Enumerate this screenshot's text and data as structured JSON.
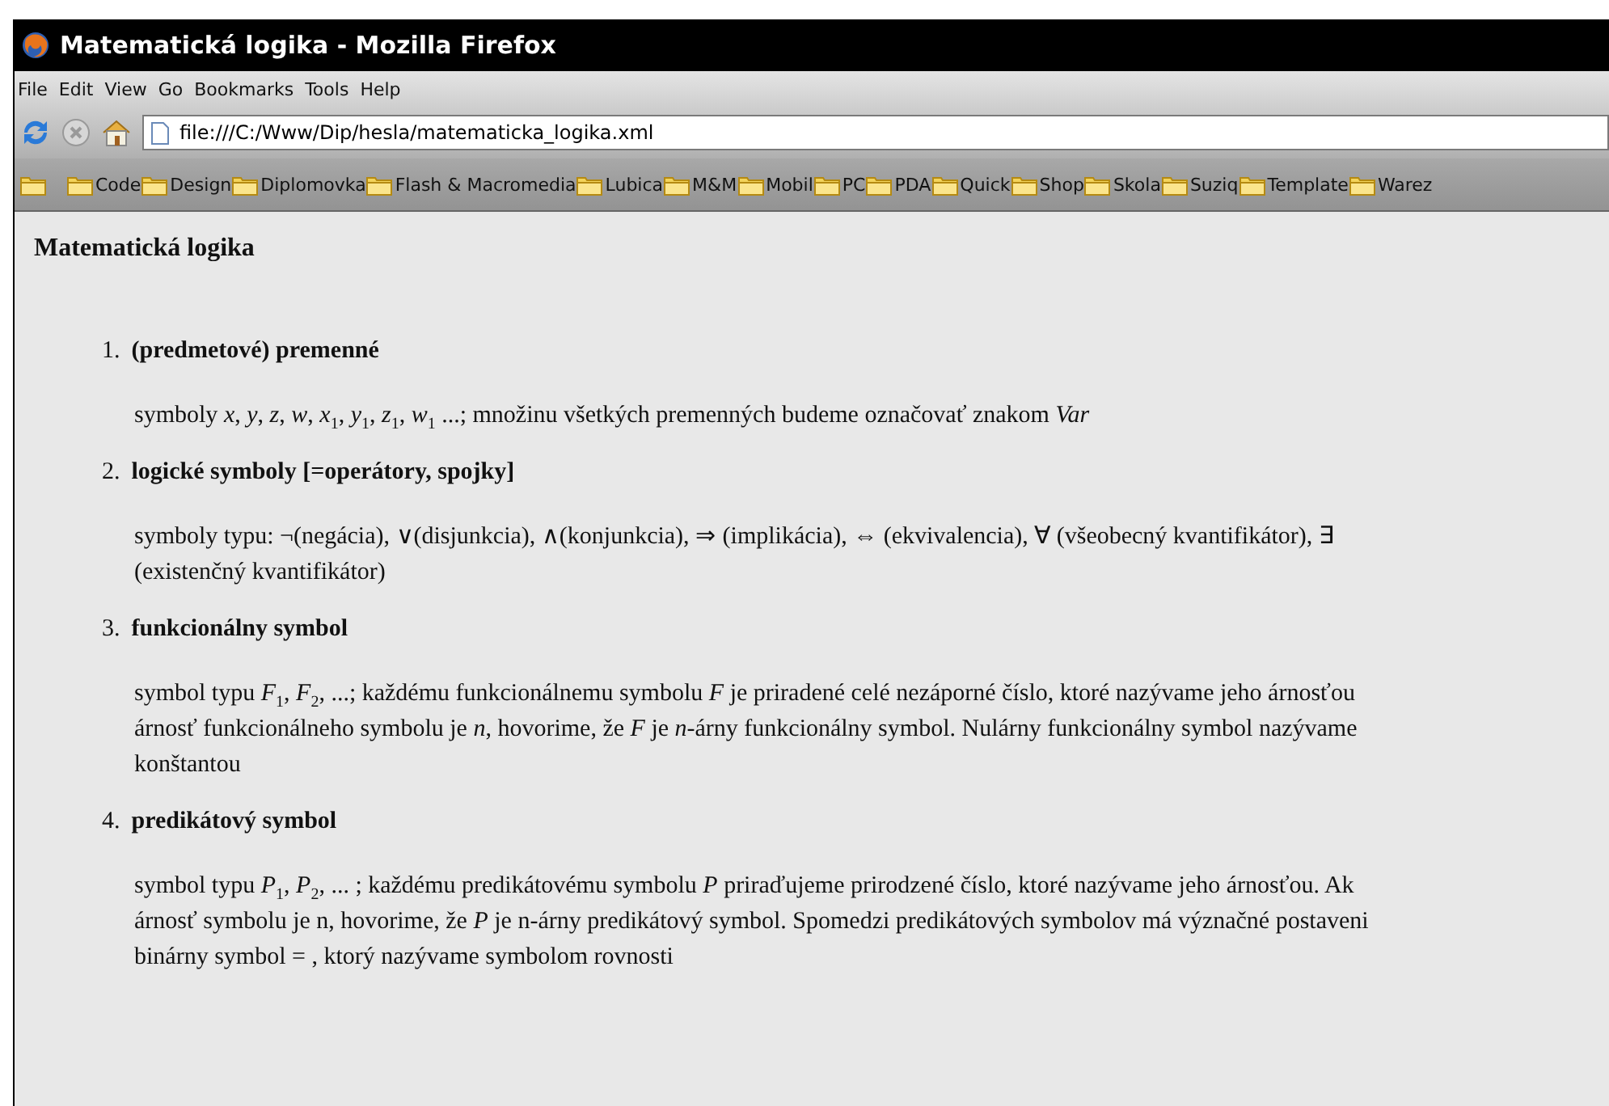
{
  "window": {
    "title": "Matematická logika - Mozilla Firefox"
  },
  "menu": [
    "File",
    "Edit",
    "View",
    "Go",
    "Bookmarks",
    "Tools",
    "Help"
  ],
  "address": {
    "value": "file:///C:/Www/Dip/hesla/matematicka_logika.xml"
  },
  "bookmarks": [
    "Code",
    "Design",
    "Diplomovka",
    "Flash & Macromedia",
    "Lubica",
    "M&M",
    "Mobil",
    "PC",
    "PDA",
    "Quick",
    "Shop",
    "Skola",
    "Suziq",
    "Template",
    "Warez"
  ],
  "page": {
    "heading": "Matematická logika",
    "items": [
      {
        "number": "1.",
        "title": "(predmetové) premenné",
        "lines": [
          "symboly *x*, *y*, *z*, *w*, *x*$_{1}$, *y*$_{1}$, *z*$_{1}$, *w*$_{1}$ ...; množinu všetkých premenných budeme označovať znakom *Var*"
        ]
      },
      {
        "number": "2.",
        "title": "logické symboly [=operátory, spojky]",
        "lines": [
          "symboly typu: ¬(negácia), ∨(disjunkcia), ∧(konjunkcia),  ⇒ (implikácia),  ⇔ (ekvivalencia), ∀ (všeobecný kvantifikátor), ∃",
          "(existenčný kvantifikátor)"
        ]
      },
      {
        "number": "3.",
        "title": "funkcionálny symbol",
        "lines": [
          "symbol typu *F*$_{1}$, *F*$_{2}$, ...; každému funkcionálnemu symbolu *F* je priradené celé nezáporné číslo, ktoré nazývame jeho árnosťou",
          "árnosť funkcionálneho symbolu je *n*, hovorime, že *F* je *n*-árny funkcionálny symbol. Nulárny funkcionálny symbol nazývame",
          "konštantou"
        ]
      },
      {
        "number": "4.",
        "title": "predikátový symbol",
        "lines": [
          "symbol typu *P*$_{1}$, *P*$_{2}$, ... ; každému predikátovému symbolu *P* priraďujeme prirodzené číslo, ktoré nazývame jeho árnosťou. Ak",
          "árnosť symbolu je n, hovorime, že *P* je n-árny predikátový symbol. Spomedzi predikátových symbolov má význačné postaveni",
          "binárny symbol  = , ktorý nazývame symbolom rovnosti"
        ]
      }
    ]
  }
}
